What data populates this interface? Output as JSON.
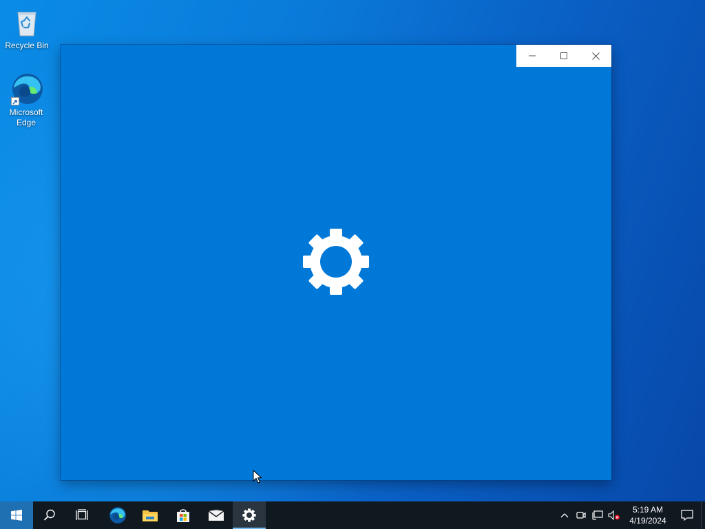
{
  "desktop": {
    "icons": [
      {
        "label": "Recycle Bin",
        "icon": "recycle-bin-icon"
      },
      {
        "label": "Microsoft\nEdge",
        "icon": "edge-icon"
      }
    ]
  },
  "window": {
    "app": "Settings",
    "splash_icon": "gear-icon",
    "background": "#0078d7",
    "buttons": {
      "minimize": "minimize-icon",
      "maximize": "maximize-icon",
      "close": "close-icon"
    }
  },
  "taskbar": {
    "start": "windows-logo-icon",
    "search": "search-icon",
    "task_view": "task-view-icon",
    "pinned": [
      {
        "name": "Microsoft Edge",
        "icon": "edge-icon"
      },
      {
        "name": "File Explorer",
        "icon": "folder-icon"
      },
      {
        "name": "Microsoft Store",
        "icon": "store-icon"
      },
      {
        "name": "Mail",
        "icon": "mail-icon"
      },
      {
        "name": "Settings",
        "icon": "gear-icon",
        "active": true
      }
    ],
    "tray": {
      "icons": [
        "chevron-up-icon",
        "meet-now-icon",
        "network-icon",
        "volume-muted-icon"
      ],
      "time": "5:19 AM",
      "date": "4/19/2024",
      "notification": "action-center-icon"
    }
  },
  "colors": {
    "accent": "#0078d7",
    "taskbar": "#101820",
    "active_indicator": "#76b9ed"
  }
}
